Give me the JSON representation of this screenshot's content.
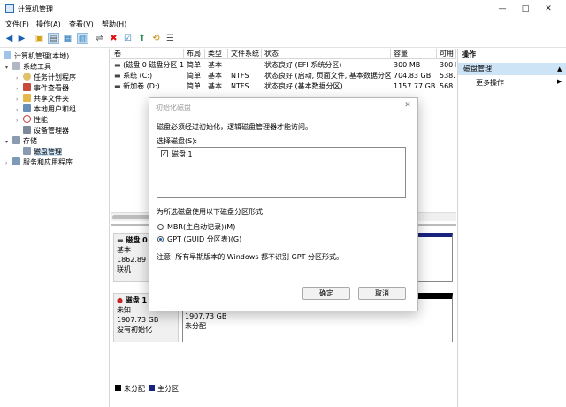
{
  "window": {
    "title": "计算机管理",
    "minimize": "—",
    "maximize": "□",
    "close": "✕"
  },
  "menu": [
    "文件(F)",
    "操作(A)",
    "查看(V)",
    "帮助(H)"
  ],
  "toolbar": {
    "icons": [
      "back-arrow",
      "forward-arrow",
      "folder",
      "console",
      "properties",
      "help",
      "connect",
      "delete",
      "check",
      "import",
      "refresh",
      "list-view"
    ]
  },
  "tree": [
    {
      "label": "计算机管理(本地)"
    },
    {
      "label": "系统工具"
    },
    {
      "label": "任务计划程序"
    },
    {
      "label": "事件查看器"
    },
    {
      "label": "共享文件夹"
    },
    {
      "label": "本地用户和组"
    },
    {
      "label": "性能"
    },
    {
      "label": "设备管理器"
    },
    {
      "label": "存储"
    },
    {
      "label": "磁盘管理"
    },
    {
      "label": "服务和应用程序"
    }
  ],
  "volumes": {
    "headers": [
      "卷",
      "布局",
      "类型",
      "文件系统",
      "状态",
      "容量",
      "可用"
    ],
    "rows": [
      [
        "(磁盘 0 磁盘分区 1)",
        "简单",
        "基本",
        "",
        "状态良好 (EFI 系统分区)",
        "300 MB",
        "300 MB"
      ],
      [
        "系统 (C:)",
        "简单",
        "基本",
        "NTFS",
        "状态良好 (启动, 页面文件, 基本数据分区)",
        "704.83 GB",
        "538."
      ],
      [
        "新加卷 (D:)",
        "简单",
        "基本",
        "NTFS",
        "状态良好 (基本数据分区)",
        "1157.77 GB",
        "568."
      ]
    ]
  },
  "disks": [
    {
      "name": "磁盘 0",
      "type": "基本",
      "size": "1862.89 GB",
      "status": "联机"
    },
    {
      "name": "磁盘 1",
      "type": "未知",
      "size": "1907.73 GB",
      "status": "没有初始化",
      "bar_size": "1907.73 GB",
      "bar_status": "未分配"
    }
  ],
  "legend": [
    {
      "label": "未分配",
      "color": "#000000"
    },
    {
      "label": "主分区",
      "color": "#1a237e"
    }
  ],
  "actions": {
    "header": "操作",
    "selected": "磁盘管理",
    "more": "更多操作"
  },
  "dialog": {
    "title": "初始化磁盘",
    "intro": "磁盘必须经过初始化，逻辑磁盘管理器才能访问。",
    "select_label": "选择磁盘(S):",
    "disk_item": "磁盘 1",
    "style_label": "为所选磁盘使用以下磁盘分区形式:",
    "option_mbr": "MBR(主启动记录)(M)",
    "option_gpt": "GPT (GUID 分区表)(G)",
    "note": "注意: 所有早期版本的 Windows 都不识别 GPT 分区形式。",
    "ok": "确定",
    "cancel": "取消"
  }
}
